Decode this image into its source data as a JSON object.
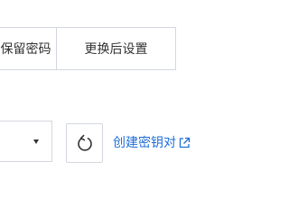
{
  "options": {
    "keep_label": "保留密码",
    "change_label": "更换后设置"
  },
  "key_select": {
    "value": ""
  },
  "refresh_icon": "refresh-icon",
  "create_link": {
    "label": "创建密钥对",
    "icon": "external-link-icon",
    "color": "#1f6fd6"
  }
}
